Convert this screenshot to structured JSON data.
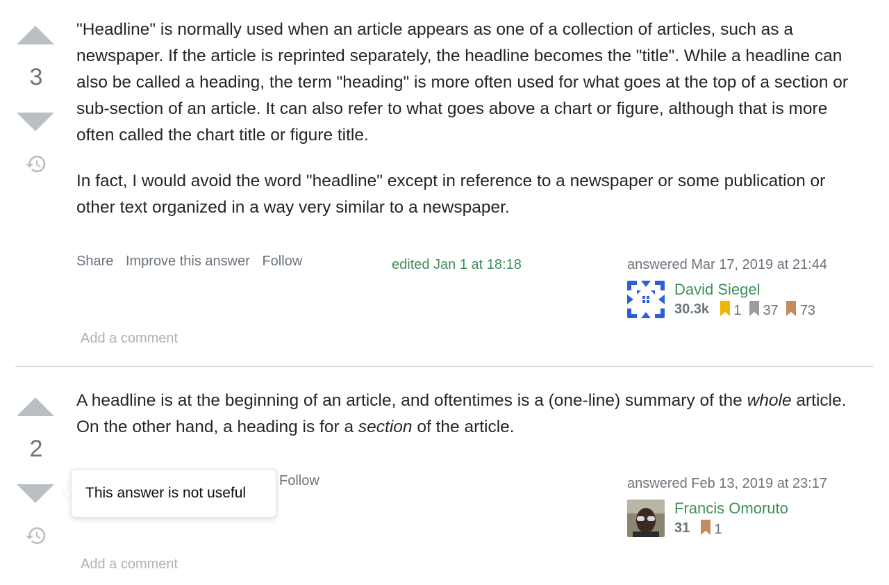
{
  "answers": [
    {
      "vote_count": "3",
      "paragraphs": [
        "\"Headline\" is normally used when an article appears as one of a collection of articles, such as a newspaper. If the article is reprinted separately, the headline becomes the \"title\". While a headline can also be called a heading, the term \"heading\" is more often used for what goes at the top of a section or sub-section of an article. It can also refer to what goes above a chart or figure, although that is more often called the chart title or figure title.",
        "In fact, I would avoid the word \"headline\" except in reference to a newspaper or some publication or other text organized in a way very similar to a newspaper."
      ],
      "menu": {
        "share": "Share",
        "improve": "Improve this answer",
        "follow": "Follow"
      },
      "edited": "edited Jan 1 at 18:18",
      "answered": "answered Mar 17, 2019 at 21:44",
      "user": {
        "name": "David Siegel",
        "reputation": "30.3k",
        "gold": "1",
        "silver": "37",
        "bronze": "73"
      },
      "add_comment": "Add a comment"
    },
    {
      "vote_count": "2",
      "menu": {
        "follow": "Follow"
      },
      "answered": "answered Feb 13, 2019 at 23:17",
      "user": {
        "name": "Francis Omoruto",
        "reputation": "31",
        "bronze": "1"
      },
      "add_comment": "Add a comment"
    }
  ],
  "answer2_text": {
    "part1": "A headline is at the beginning of an article, and oftentimes is a (one-line) summary of the ",
    "em1": "whole",
    "part2": " article. On the other hand, a heading is for a ",
    "em2": "section",
    "part3": " of the article."
  },
  "tooltip": "This answer is not useful",
  "colors": {
    "link_green": "#3d8f58",
    "muted": "#6a737c",
    "vote_arrow": "#babfc4",
    "gold": "#f1b600",
    "silver": "#9a9c9f",
    "bronze": "#c38b5f"
  }
}
